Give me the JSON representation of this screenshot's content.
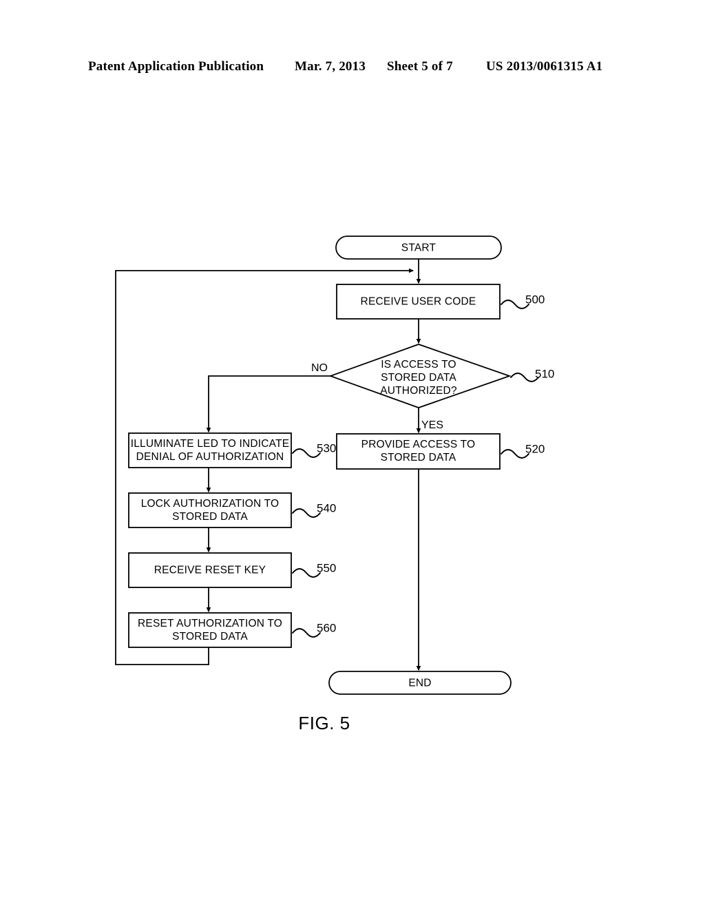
{
  "header": {
    "publication": "Patent Application Publication",
    "date": "Mar. 7, 2013",
    "sheet": "Sheet 5 of 7",
    "number": "US 2013/0061315 A1"
  },
  "figure": {
    "caption": "FIG. 5",
    "nodes": {
      "start": {
        "label": "START",
        "shape": "terminator"
      },
      "receive_user_code": {
        "line1": "RECEIVE USER CODE",
        "ref": "500",
        "shape": "process"
      },
      "decision": {
        "line1": "IS ACCESS TO",
        "line2": "STORED DATA",
        "line3": "AUTHORIZED?",
        "ref": "510",
        "shape": "decision",
        "branch_no": "NO",
        "branch_yes": "YES"
      },
      "provide_access": {
        "line1": "PROVIDE ACCESS TO",
        "line2": "STORED DATA",
        "ref": "520",
        "shape": "process"
      },
      "illuminate_led": {
        "line1": "ILLUMINATE LED TO INDICATE",
        "line2": "DENIAL OF AUTHORIZATION",
        "ref": "530",
        "shape": "process"
      },
      "lock_authorization": {
        "line1": "LOCK AUTHORIZATION TO",
        "line2": "STORED DATA",
        "ref": "540",
        "shape": "process"
      },
      "receive_reset_key": {
        "line1": "RECEIVE RESET KEY",
        "ref": "550",
        "shape": "process"
      },
      "reset_authorization": {
        "line1": "RESET AUTHORIZATION TO",
        "line2": "STORED DATA",
        "ref": "560",
        "shape": "process"
      },
      "end": {
        "label": "END",
        "shape": "terminator"
      }
    }
  },
  "colors": {
    "ink": "#000000",
    "paper": "#ffffff"
  }
}
